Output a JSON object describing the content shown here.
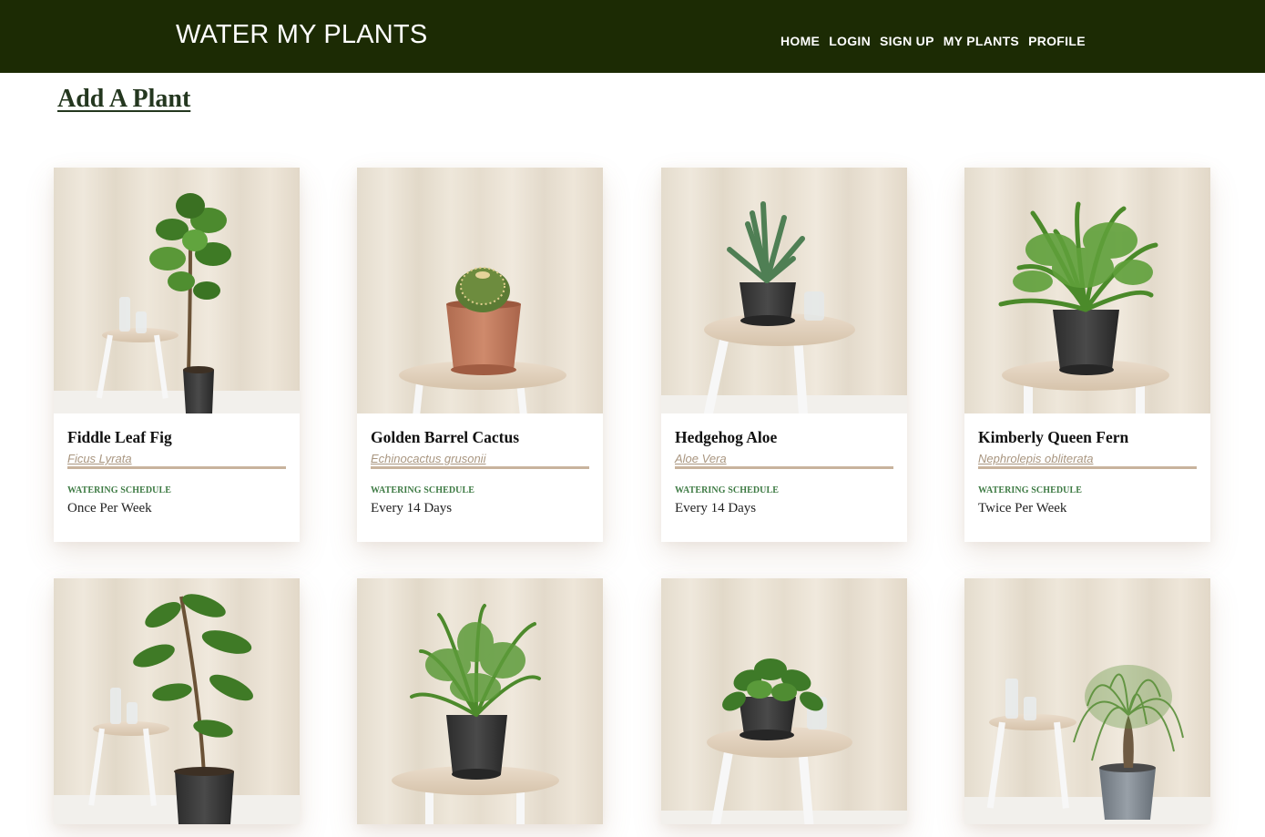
{
  "header": {
    "title": "WATER MY PLANTS",
    "nav": [
      "HOME",
      "LOGIN",
      "SIGN UP",
      "MY PLANTS",
      "PROFILE"
    ]
  },
  "page": {
    "add_link": "Add A Plant"
  },
  "colors": {
    "header_bg": "#1c2b04",
    "accent_green": "#3d7a43",
    "species_tan": "#a99680"
  },
  "plants": [
    {
      "name": "Fiddle Leaf Fig",
      "species": "Ficus Lyrata",
      "schedule_label": "WATERING SCHEDULE",
      "schedule": "Once Per Week",
      "image": "fiddle-leaf-fig-photo"
    },
    {
      "name": "Golden Barrel Cactus",
      "species": "Echinocactus grusonii",
      "schedule_label": "WATERING SCHEDULE",
      "schedule": "Every 14 Days",
      "image": "golden-barrel-cactus-photo"
    },
    {
      "name": "Hedgehog Aloe",
      "species": "Aloe Vera",
      "schedule_label": "WATERING SCHEDULE",
      "schedule": "Every 14 Days",
      "image": "hedgehog-aloe-photo"
    },
    {
      "name": "Kimberly Queen Fern",
      "species": "Nephrolepis obliterata",
      "schedule_label": "WATERING SCHEDULE",
      "schedule": "Twice Per Week",
      "image": "kimberly-queen-fern-photo"
    },
    {
      "image": "rubber-tree-photo"
    },
    {
      "image": "parlor-palm-photo"
    },
    {
      "image": "pothos-photo"
    },
    {
      "image": "ponytail-palm-photo"
    }
  ]
}
